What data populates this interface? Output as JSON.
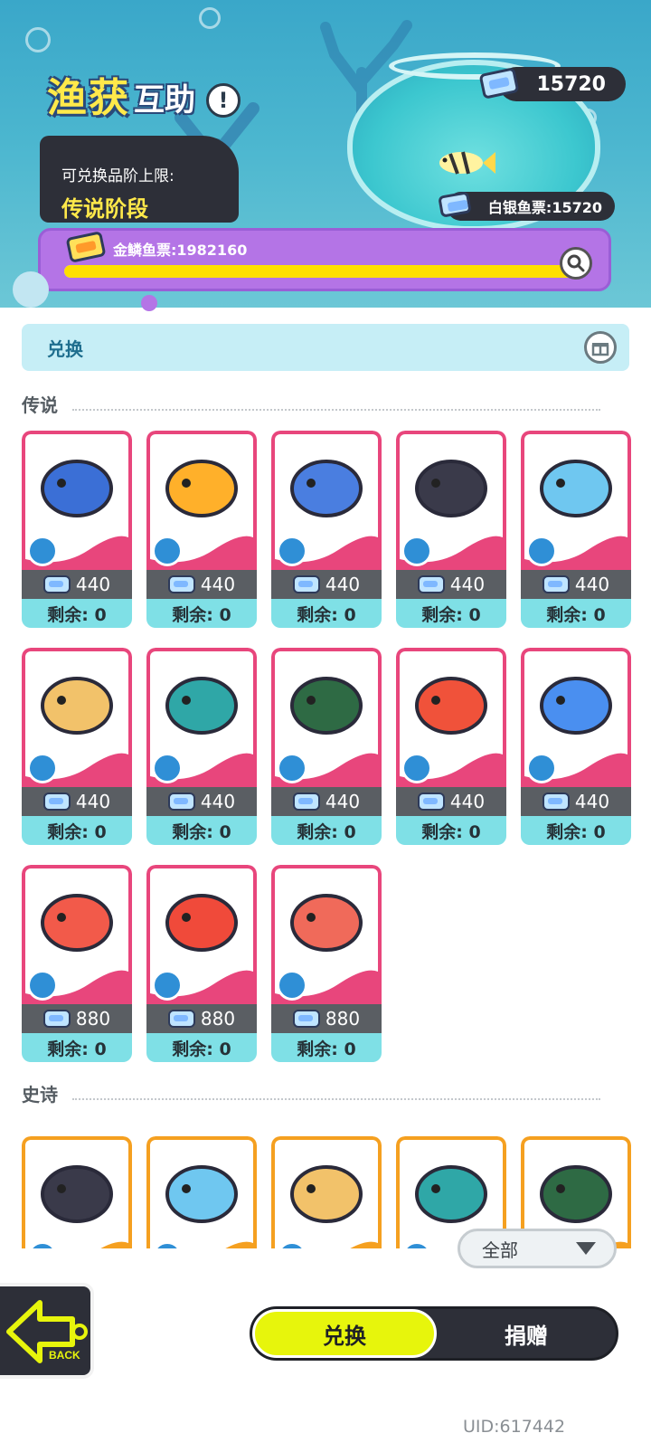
{
  "header": {
    "title_main": "渔获",
    "title_sub": "互助",
    "info_icon": "exclamation-icon",
    "tier_label": "可兑换品阶上限:",
    "tier_value": "传说阶段",
    "ticket_count": "15720",
    "silver_ticket": "白银鱼票:15720",
    "gold_ticket": "金鳞鱼票:1982160",
    "gold_progress_fraction": 0.98
  },
  "exchange_bar": {
    "label": "兑换",
    "icon": "gift-icon"
  },
  "sections": {
    "legendary": {
      "title": "传说",
      "items": [
        {
          "icon": "fish-icon",
          "price": "440",
          "stock": "剩余: 0"
        },
        {
          "icon": "fish-icon",
          "price": "440",
          "stock": "剩余: 0"
        },
        {
          "icon": "chef-bird-icon",
          "price": "440",
          "stock": "剩余: 0"
        },
        {
          "icon": "diver-icon",
          "price": "440",
          "stock": "剩余: 0"
        },
        {
          "icon": "coral-icon",
          "price": "440",
          "stock": "剩余: 0"
        },
        {
          "icon": "fossil-fish-icon",
          "price": "440",
          "stock": "剩余: 0"
        },
        {
          "icon": "whale-icon",
          "price": "440",
          "stock": "剩余: 0"
        },
        {
          "icon": "turtle-icon",
          "price": "440",
          "stock": "剩余: 0"
        },
        {
          "icon": "anemone-icon",
          "price": "440",
          "stock": "剩余: 0"
        },
        {
          "icon": "flying-fish-icon",
          "price": "440",
          "stock": "剩余: 0"
        },
        {
          "icon": "goldfish-icon",
          "price": "880",
          "stock": "剩余: 0"
        },
        {
          "icon": "orb-icon",
          "price": "880",
          "stock": "剩余: 0"
        },
        {
          "icon": "red-coral-icon",
          "price": "880",
          "stock": "剩余: 0"
        }
      ]
    },
    "epic": {
      "title": "史诗",
      "items": [
        {
          "icon": "blue-tang-icon"
        },
        {
          "icon": "butterflyfish-icon"
        },
        {
          "icon": "dolphin-icon"
        },
        {
          "icon": "sponge-icon"
        },
        {
          "icon": "nautilus-icon"
        }
      ]
    }
  },
  "filter": {
    "label": "全部"
  },
  "back": {
    "label": "BACK"
  },
  "tabs": {
    "exchange": "兑换",
    "donate": "捐赠"
  },
  "uid": "UID:617442",
  "colors": {
    "legendary_border": "#e8467c",
    "epic_border": "#f5a020",
    "accent_yellow": "#e7f50c",
    "gold_panel": "#b474e6"
  }
}
